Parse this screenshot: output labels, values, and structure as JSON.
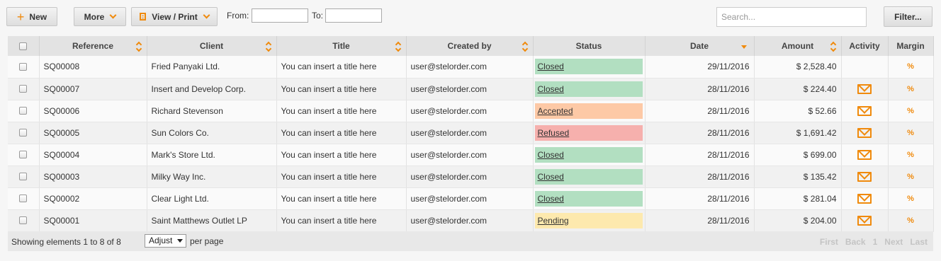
{
  "toolbar": {
    "new_label": "New",
    "more_label": "More",
    "view_print_label": "View / Print",
    "from_label": "From:",
    "to_label": "To:",
    "from_value": "",
    "to_value": "",
    "search_placeholder": "Search...",
    "filter_label": "Filter..."
  },
  "table": {
    "columns": {
      "reference": "Reference",
      "client": "Client",
      "title": "Title",
      "created_by": "Created by",
      "status": "Status",
      "date": "Date",
      "amount": "Amount",
      "activity": "Activity",
      "margin": "Margin"
    },
    "rows": [
      {
        "reference": "SQ00008",
        "client": "Fried Panyaki Ltd.",
        "title": "You can insert a title here",
        "created_by": "user@stelorder.com",
        "status": "Closed",
        "status_kind": "closed",
        "date": "29/11/2016",
        "amount": "$ 2,528.40",
        "has_activity": false,
        "margin": "%"
      },
      {
        "reference": "SQ00007",
        "client": "Insert and Develop Corp.",
        "title": "You can insert a title here",
        "created_by": "user@stelorder.com",
        "status": "Closed",
        "status_kind": "closed",
        "date": "28/11/2016",
        "amount": "$ 224.40",
        "has_activity": true,
        "margin": "%"
      },
      {
        "reference": "SQ00006",
        "client": "Richard Stevenson",
        "title": "You can insert a title here",
        "created_by": "user@stelorder.com",
        "status": "Accepted",
        "status_kind": "accepted",
        "date": "28/11/2016",
        "amount": "$ 52.66",
        "has_activity": true,
        "margin": "%"
      },
      {
        "reference": "SQ00005",
        "client": "Sun Colors Co.",
        "title": "You can insert a title here",
        "created_by": "user@stelorder.com",
        "status": "Refused",
        "status_kind": "refused",
        "date": "28/11/2016",
        "amount": "$ 1,691.42",
        "has_activity": true,
        "margin": "%"
      },
      {
        "reference": "SQ00004",
        "client": "Mark's Store Ltd.",
        "title": "You can insert a title here",
        "created_by": "user@stelorder.com",
        "status": "Closed",
        "status_kind": "closed",
        "date": "28/11/2016",
        "amount": "$ 699.00",
        "has_activity": true,
        "margin": "%"
      },
      {
        "reference": "SQ00003",
        "client": "Milky Way Inc.",
        "title": "You can insert a title here",
        "created_by": "user@stelorder.com",
        "status": "Closed",
        "status_kind": "closed",
        "date": "28/11/2016",
        "amount": "$ 135.42",
        "has_activity": true,
        "margin": "%"
      },
      {
        "reference": "SQ00002",
        "client": "Clear Light Ltd.",
        "title": "You can insert a title here",
        "created_by": "user@stelorder.com",
        "status": "Closed",
        "status_kind": "closed",
        "date": "28/11/2016",
        "amount": "$ 281.04",
        "has_activity": true,
        "margin": "%"
      },
      {
        "reference": "SQ00001",
        "client": "Saint Matthews Outlet LP",
        "title": "You can insert a title here",
        "created_by": "user@stelorder.com",
        "status": "Pending",
        "status_kind": "pending",
        "date": "28/11/2016",
        "amount": "$ 204.00",
        "has_activity": true,
        "margin": "%"
      }
    ]
  },
  "status_colors": {
    "closed": "#b2dfc1",
    "accepted": "#fdc9a6",
    "refused": "#f6b0ad",
    "pending": "#fde9ae"
  },
  "accent_color": "#f08a0c",
  "footer": {
    "showing_text": "Showing elements 1 to 8 of 8",
    "page_size_value": "Adjust",
    "per_page_label": "per page",
    "pager": {
      "first": "First",
      "back": "Back",
      "page": "1",
      "next": "Next",
      "last": "Last"
    }
  }
}
